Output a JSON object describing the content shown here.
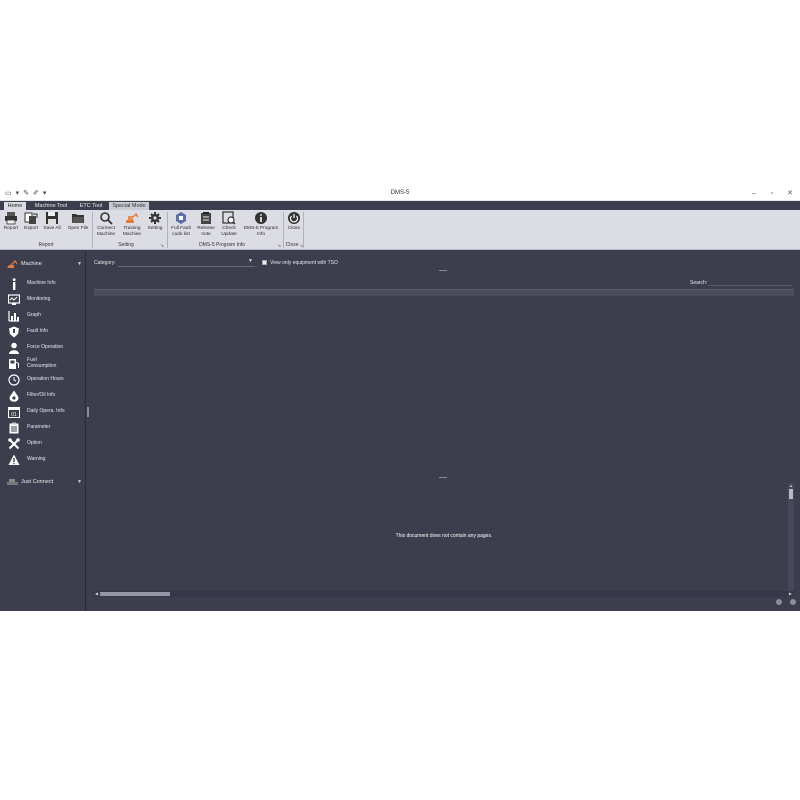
{
  "window": {
    "title": "DMS-5",
    "quick_access": [
      "▭",
      "▾",
      "✎",
      "✐",
      "▾"
    ],
    "controls": [
      "–",
      "▫",
      "✕"
    ]
  },
  "ribbon": {
    "tabs": [
      "Home",
      "Machine Tool",
      "ETC Tool",
      "Special Mode"
    ],
    "active_tab": "Home",
    "groups": {
      "report": {
        "label": "Report",
        "buttons": [
          "Report",
          "Export",
          "Save All",
          "Open File"
        ]
      },
      "setting": {
        "label": "Setting",
        "buttons": [
          "Connect Machine",
          "Training Machine",
          "Setting"
        ]
      },
      "program_info": {
        "label": "DMS-5 Program Info",
        "buttons": [
          "Full Fault code list",
          "Release note",
          "Check Update",
          "DMS-5 Program Info"
        ]
      },
      "close": {
        "label": "Close",
        "buttons": [
          "Close"
        ]
      }
    }
  },
  "sidebar": {
    "header": "Machine",
    "items": [
      {
        "label": "Machine Info",
        "icon": "info-icon"
      },
      {
        "label": "Monitoring",
        "icon": "monitor-icon"
      },
      {
        "label": "Graph",
        "icon": "graph-icon"
      },
      {
        "label": "Fault Info",
        "icon": "shield-icon"
      },
      {
        "label": "Force Operation",
        "icon": "user-icon"
      },
      {
        "label": "Fuel Consumption",
        "icon": "fuel-icon"
      },
      {
        "label": "Operation Hours",
        "icon": "clock-icon"
      },
      {
        "label": "Filter/Oil Info",
        "icon": "oil-drop-icon"
      },
      {
        "label": "Daily Opera. Info",
        "icon": "calendar-icon"
      },
      {
        "label": "Parameter",
        "icon": "clipboard-icon"
      },
      {
        "label": "Option",
        "icon": "tools-icon"
      },
      {
        "label": "Warning",
        "icon": "warning-icon"
      }
    ],
    "connect": "Just Connect"
  },
  "main": {
    "category_label": "Category:",
    "category_value": "",
    "tso_label": "View only equipment with TSO",
    "tso_checked": false,
    "search_label": "Search:",
    "search_value": "",
    "doc_message": "This document does not contain any pages."
  }
}
